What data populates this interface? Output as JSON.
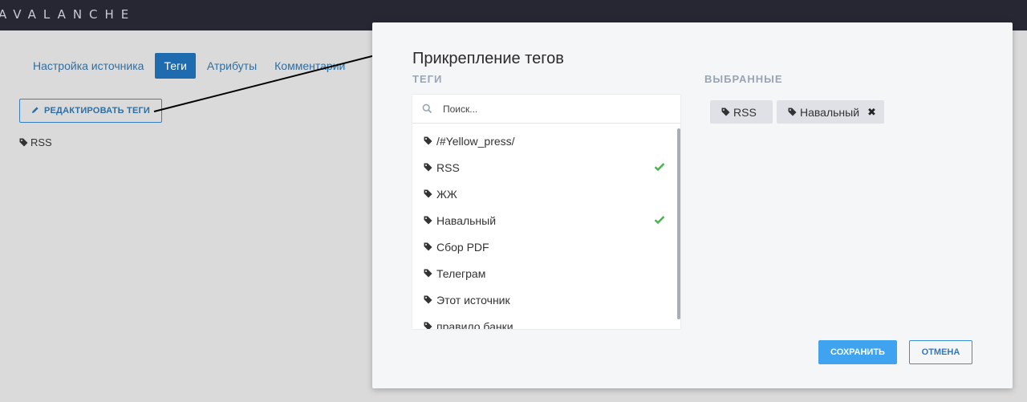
{
  "app": {
    "logo": "AVALANCHE"
  },
  "tabs": [
    {
      "label": "Настройка источника"
    },
    {
      "label": "Теги",
      "active": true
    },
    {
      "label": "Атрибуты"
    },
    {
      "label": "Комментарии"
    }
  ],
  "page": {
    "edit_button": "РЕДАКТИРОВАТЬ ТЕГИ",
    "tag": "RSS"
  },
  "modal": {
    "title": "Прикрепление тегов",
    "tags_label": "ТЕГИ",
    "selected_label": "ВЫБРАННЫЕ",
    "search": {
      "placeholder": "Поиск..."
    },
    "items": [
      {
        "label": "/#Yellow_press/",
        "checked": false
      },
      {
        "label": "RSS",
        "checked": true
      },
      {
        "label": "ЖЖ",
        "checked": false
      },
      {
        "label": "Навальный",
        "checked": true
      },
      {
        "label": "Сбор PDF",
        "checked": false
      },
      {
        "label": "Телеграм",
        "checked": false
      },
      {
        "label": "Этот источник",
        "checked": false
      },
      {
        "label": "правило банки",
        "checked": false
      }
    ],
    "selected": [
      {
        "label": "RSS",
        "removable": false
      },
      {
        "label": "Навальный",
        "removable": true
      }
    ],
    "save_button": "СОХРАНИТЬ",
    "cancel_button": "ОТМЕНА",
    "remove_glyph": "✖"
  },
  "colors": {
    "topbar": "#262733",
    "accent": "#1e6bb0",
    "save": "#3fa3ef",
    "check": "#43b649"
  }
}
